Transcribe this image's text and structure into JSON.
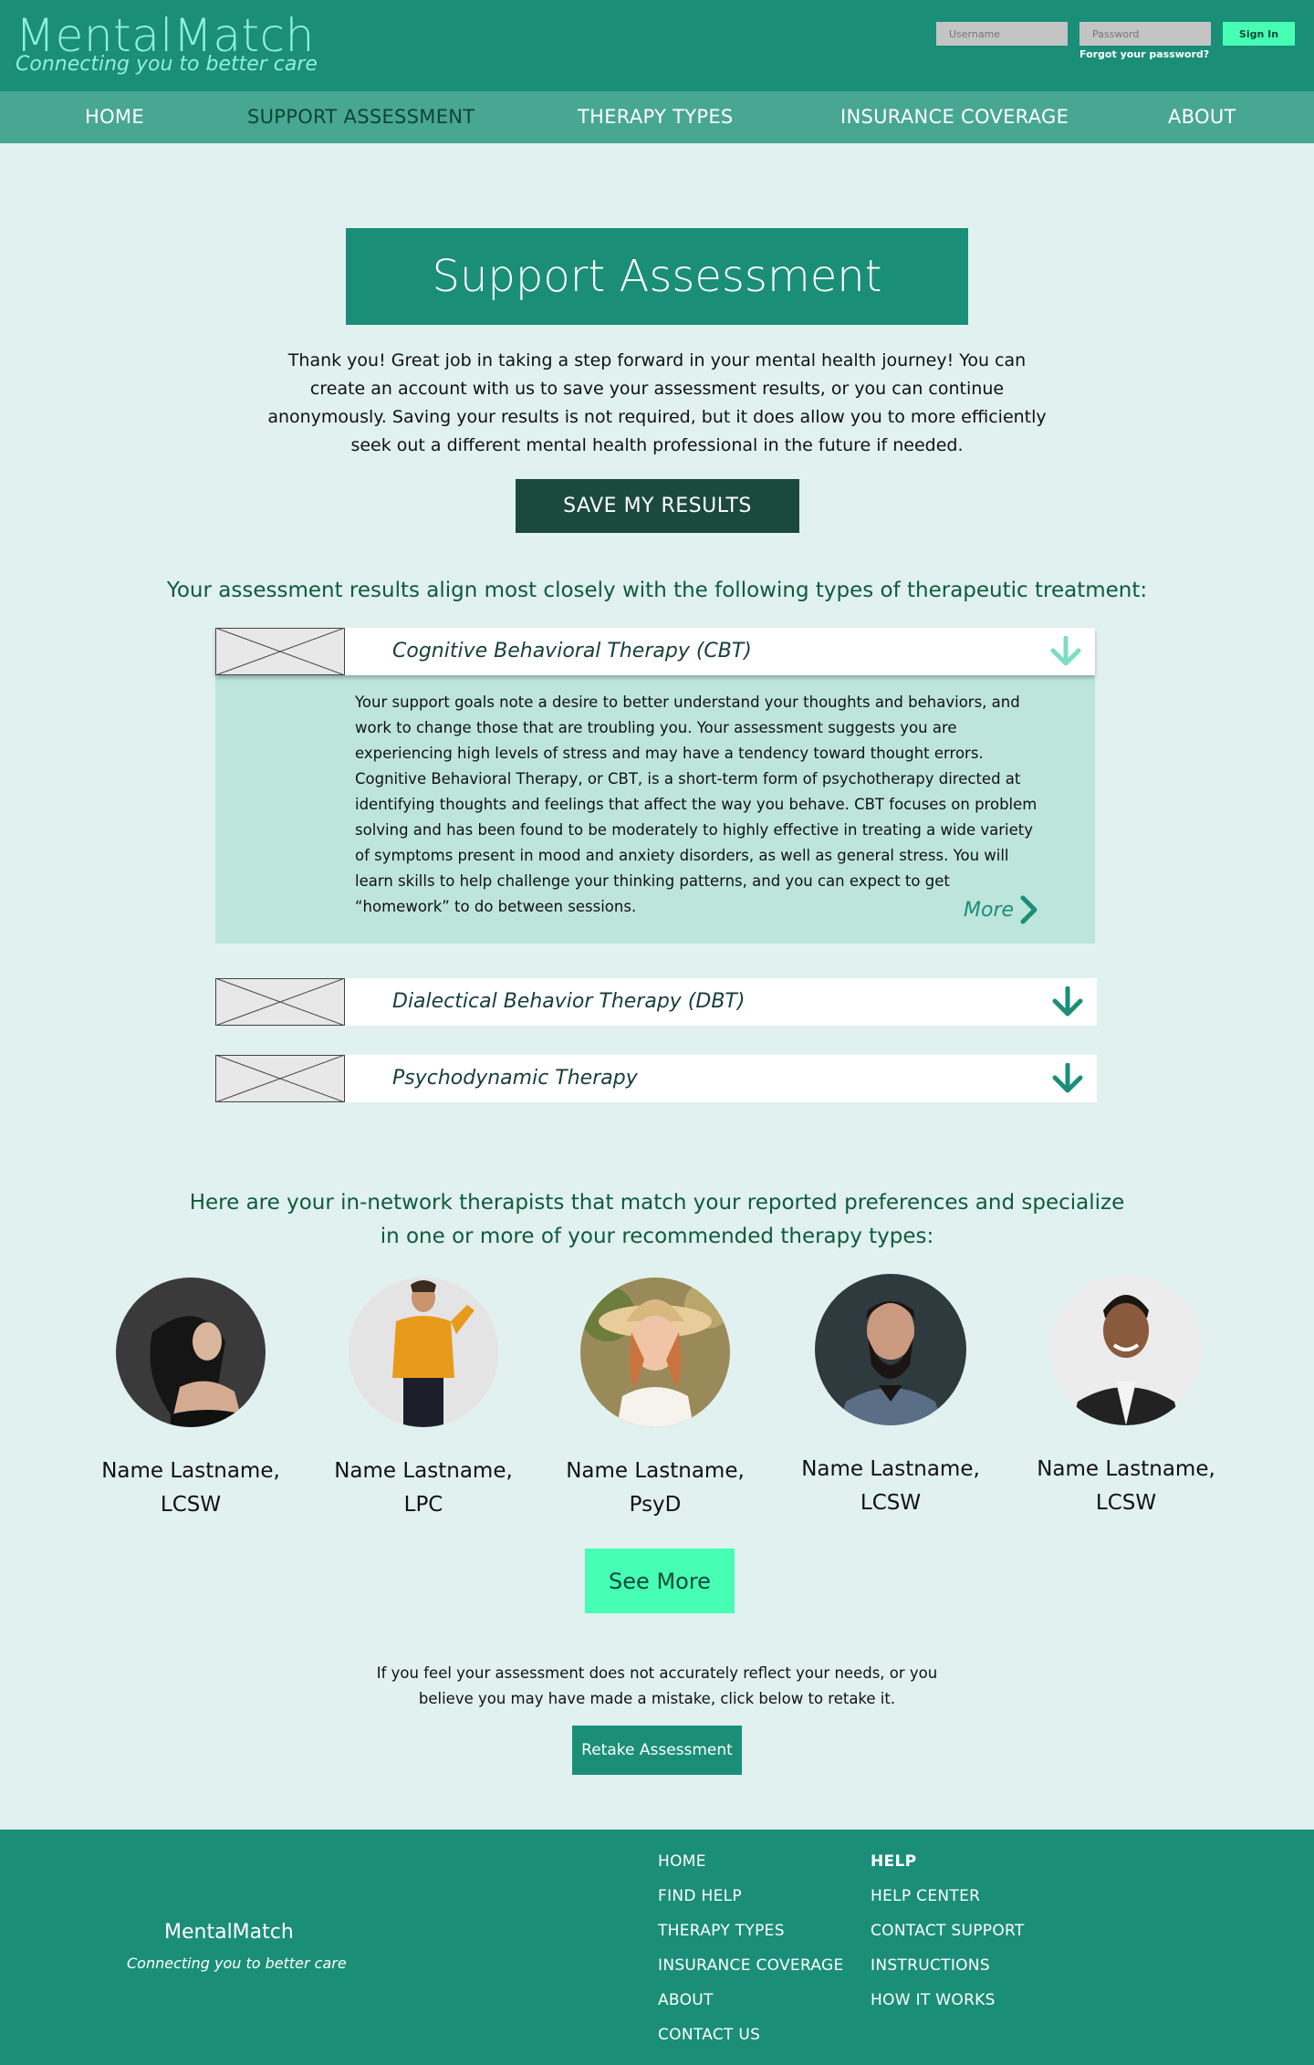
{
  "header": {
    "logo": "MentalMatch",
    "tagline": "Connecting you to better care",
    "username_placeholder": "Username",
    "password_placeholder": "Password",
    "signin_label": "Sign In",
    "forgot_label": "Forgot your password?"
  },
  "nav": {
    "items": [
      "HOME",
      "SUPPORT ASSESSMENT",
      "THERAPY TYPES",
      "INSURANCE COVERAGE",
      "ABOUT"
    ],
    "active": "SUPPORT ASSESSMENT"
  },
  "main": {
    "title": "Support Assessment",
    "intro": "Thank you! Great job in taking a step forward in your mental health journey! You can create an account with us to save your assessment results, or you can continue anonymously. Saving your results is not required, but it does allow you to more efficiently seek out a different mental health professional in the future if needed.",
    "save_label": "SAVE MY RESULTS",
    "results_heading": "Your assessment results align most closely with the following types of therapeutic treatment:"
  },
  "therapies": [
    {
      "title": "Cognitive Behavioral Therapy (CBT)",
      "expanded": true,
      "body": "Your support goals note a desire to better understand your thoughts and behaviors, and work to change those that are troubling you. Your assessment suggests you are experiencing high levels of stress and may have a tendency toward thought errors. Cognitive Behavioral Therapy, or CBT, is a short-term form of psychotherapy directed at identifying thoughts and feelings that affect the way you behave. CBT focuses on problem solving and has been found to be moderately to highly effective in treating a wide variety of symptoms present in mood and anxiety disorders, as well as general stress. You will learn skills to help challenge your thinking patterns, and you can expect to get “homework” to do between sessions.",
      "more_label": "More"
    },
    {
      "title": "Dialectical Behavior Therapy (DBT)",
      "expanded": false
    },
    {
      "title": "Psychodynamic Therapy",
      "expanded": false
    }
  ],
  "therapists": {
    "heading": "Here are your in-network therapists that match your reported preferences and specialize in one or more of your recommended therapy types:",
    "list": [
      {
        "name": "Name Lastname,",
        "credential": "LCSW"
      },
      {
        "name": "Name Lastname,",
        "credential": "LPC"
      },
      {
        "name": "Name Lastname,",
        "credential": "PsyD"
      },
      {
        "name": "Name Lastname,",
        "credential": "LCSW"
      },
      {
        "name": "Name Lastname,",
        "credential": "LCSW"
      }
    ],
    "see_more_label": "See More"
  },
  "retake": {
    "text": "If you feel your assessment does not accurately reflect your needs, or you believe you may have made a mistake, click below to retake it.",
    "button_label": "Retake Assessment"
  },
  "footer": {
    "brand": "MentalMatch",
    "tagline": "Connecting you to better care",
    "col1": [
      "HOME",
      "FIND HELP",
      "THERAPY TYPES",
      "INSURANCE COVERAGE",
      "ABOUT",
      "CONTACT US"
    ],
    "col2_heading": "HELP",
    "col2": [
      "HELP CENTER",
      "CONTACT SUPPORT",
      "INSTRUCTIONS",
      "HOW IT WORKS"
    ]
  },
  "colors": {
    "brand": "#1b8e78",
    "nav": "#48a792",
    "background": "#e0f1ef",
    "accent": "#47ffb4",
    "dark": "#1b4a3d",
    "heading": "#0f5a3c"
  },
  "icons": [
    "chevron-down-icon",
    "chevron-right-icon",
    "image-placeholder-icon"
  ]
}
